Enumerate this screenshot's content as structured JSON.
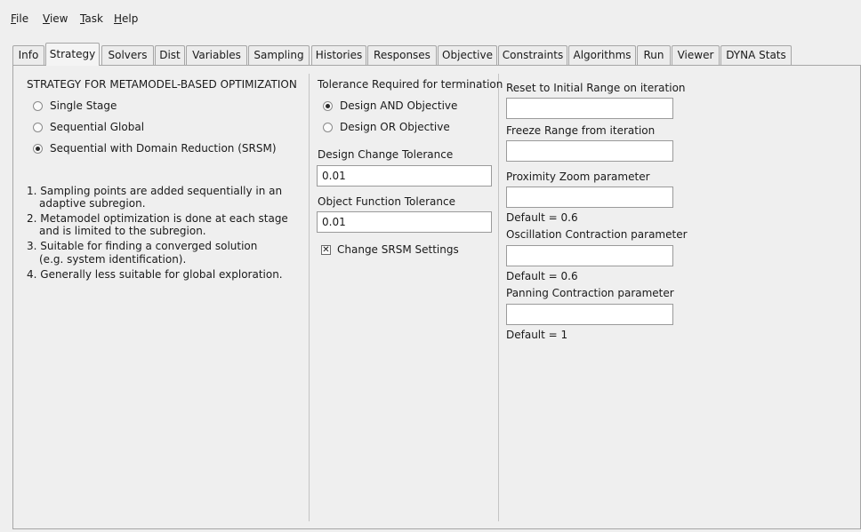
{
  "menu": [
    "File",
    "View",
    "Task",
    "Help"
  ],
  "tabs": [
    "Info",
    "Strategy",
    "Solvers",
    "Dist",
    "Variables",
    "Sampling",
    "Histories",
    "Responses",
    "Objective",
    "Constraints",
    "Algorithms",
    "Run",
    "Viewer",
    "DYNA Stats"
  ],
  "active_tab": "Strategy",
  "strategy": {
    "heading": "STRATEGY FOR METAMODEL-BASED OPTIMIZATION",
    "options": [
      "Single Stage",
      "Sequential Global",
      "Sequential with Domain Reduction (SRSM)"
    ],
    "selected": "Sequential with Domain Reduction (SRSM)",
    "notes": [
      "1. Sampling points are added sequentially in an",
      "adaptive subregion.",
      "2. Metamodel optimization is done at each stage",
      "and is limited to the subregion.",
      "3. Suitable for finding a converged solution",
      "(e.g. system identification).",
      "4. Generally less suitable for global exploration."
    ]
  },
  "tolerance": {
    "heading": "Tolerance Required for termination",
    "options": [
      "Design AND Objective",
      "Design OR Objective"
    ],
    "selected": "Design AND Objective",
    "design_change_label": "Design Change Tolerance",
    "design_change_value": "0.01",
    "object_function_label": "Object Function Tolerance",
    "object_function_value": "0.01",
    "srsm_checkbox_label": "Change SRSM Settings",
    "srsm_checked": true
  },
  "srsm": {
    "reset_label": "Reset to Initial Range on iteration",
    "reset_value": "",
    "freeze_label": "Freeze Range from iteration",
    "freeze_value": "",
    "proximity_label": "Proximity Zoom parameter",
    "proximity_value": "",
    "proximity_default": "Default = 0.6",
    "oscillation_label": "Oscillation Contraction parameter",
    "oscillation_value": "",
    "oscillation_default": "Default = 0.6",
    "panning_label": "Panning Contraction parameter",
    "panning_value": "",
    "panning_default": "Default = 1"
  }
}
